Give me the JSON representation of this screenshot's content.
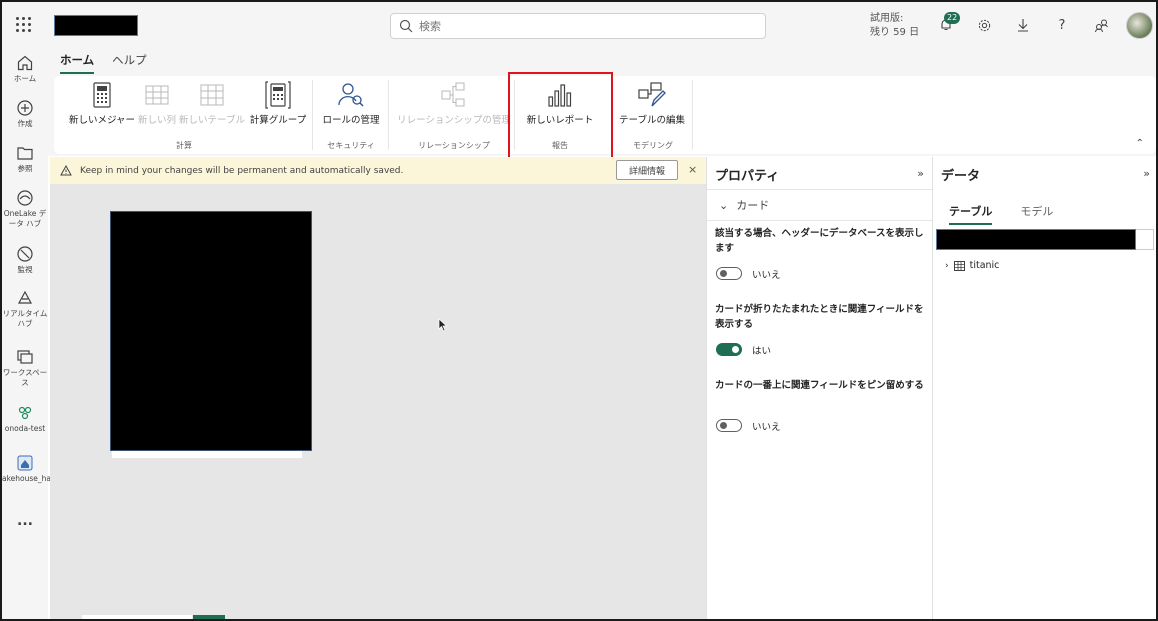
{
  "topbar": {
    "search_placeholder": "検索",
    "trial_line1": "試用版:",
    "trial_line2": "残り 59 日",
    "notification_count": "22"
  },
  "rail": {
    "items": [
      {
        "label": "ホーム",
        "icon": "home-icon"
      },
      {
        "label": "作成",
        "icon": "create-icon"
      },
      {
        "label": "参照",
        "icon": "browse-icon"
      },
      {
        "label": "OneLake データ ハブ",
        "icon": "onelake-icon"
      },
      {
        "label": "監視",
        "icon": "monitor-icon"
      },
      {
        "label": "リアルタイム ハブ",
        "icon": "realtime-icon"
      },
      {
        "label": "ワークスペース",
        "icon": "workspaces-icon"
      },
      {
        "label": "onoda-test",
        "icon": "workspace-icon"
      },
      {
        "label": "akehouse_handson",
        "icon": "lakehouse-icon"
      },
      {
        "label": "...",
        "icon": "more-icon"
      }
    ]
  },
  "ribbon": {
    "tabs": [
      "ホーム",
      "ヘルプ"
    ],
    "buttons": {
      "new_measure": "新しいメジャー",
      "new_column": "新しい列",
      "new_table": "新しいテーブル",
      "calc_group": "計算グループ",
      "manage_roles": "ロールの管理",
      "relationship": "リレーションシップの管理",
      "new_report": "新しいレポート",
      "edit_tables": "テーブルの編集"
    },
    "groups": {
      "calc": "計算",
      "security": "セキュリティ",
      "relationships": "リレーションシップ",
      "report": "報告",
      "modeling": "モデリング"
    }
  },
  "banner": {
    "message": "Keep in mind your changes will be permanent and automatically saved.",
    "details_button": "詳細情報",
    "close": "×"
  },
  "properties": {
    "title": "プロパティ",
    "section": "カード",
    "option1_label": "該当する場合、ヘッダーにデータベースを表示します",
    "option1_value": "いいえ",
    "option2_label": "カードが折りたたまれたときに関連フィールドを表示する",
    "option2_value": "はい",
    "option3_label": "カードの一番上に関連フィールドをピン留めする",
    "option3_value": "いいえ"
  },
  "data_pane": {
    "title": "データ",
    "tabs": [
      "テーブル",
      "モデル"
    ],
    "tables": [
      "titanic"
    ]
  },
  "colors": {
    "accent": "#1f6e52",
    "highlight": "#e0121b",
    "banner_bg": "#fbf6d9"
  }
}
